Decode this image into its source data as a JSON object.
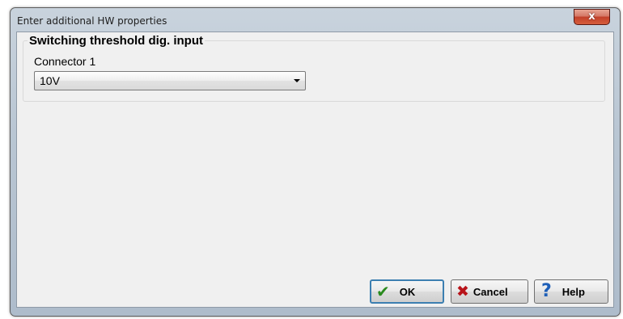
{
  "window": {
    "title": "Enter additional HW properties",
    "close_glyph": "x"
  },
  "groupbox": {
    "title": "Switching threshold dig. input",
    "connector_label": "Connector 1",
    "selected_value": "10V"
  },
  "buttons": {
    "ok": {
      "label": "OK",
      "icon": "checkmark-icon",
      "glyph": "✔"
    },
    "cancel": {
      "label": "Cancel",
      "icon": "red-x-icon",
      "glyph": "✖"
    },
    "help": {
      "label": "Help",
      "icon": "question-mark-icon",
      "glyph": "?"
    }
  },
  "colors": {
    "ok_icon": "#2a8a1e",
    "cancel_icon": "#b8141a",
    "help_icon": "#1e5fb8",
    "close_button": "#c2402a"
  }
}
